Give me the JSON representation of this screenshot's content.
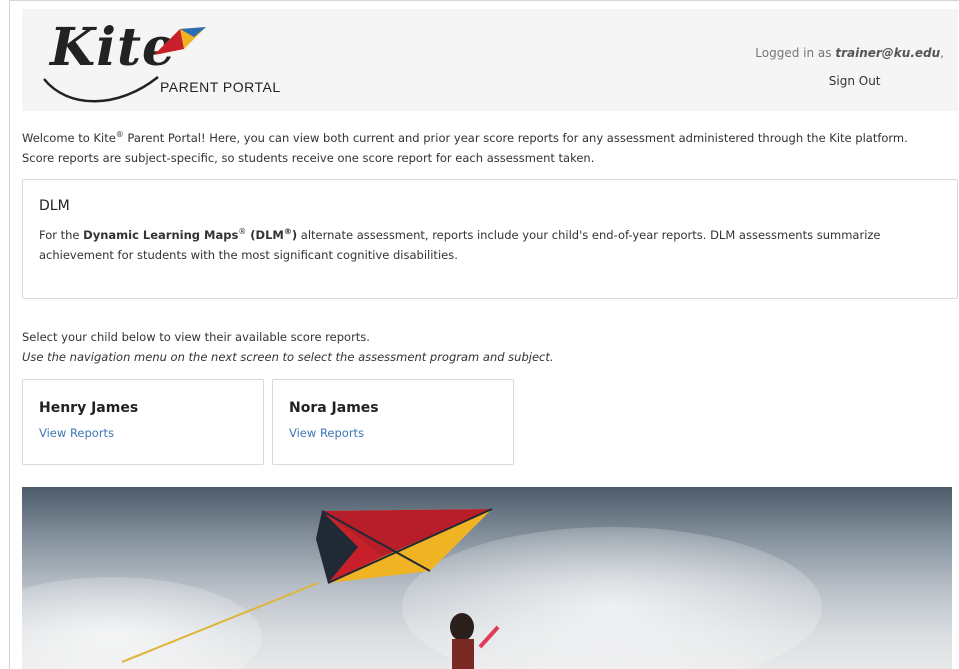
{
  "header": {
    "logo_main": "Kite",
    "logo_sub": "PARENT PORTAL",
    "logged_in_prefix": "Logged in as ",
    "user_email": "trainer@ku.edu",
    "user_suffix": ",",
    "sign_out": "Sign Out"
  },
  "intro": {
    "line1_prefix": "Welcome to Kite",
    "reg": "®",
    "line1_suffix": " Parent Portal! Here, you can view both current and prior year score reports for any assessment administered through the Kite platform.",
    "line2": "Score reports are subject-specific, so students receive one score report for each assessment taken."
  },
  "dlm": {
    "title": "DLM",
    "text_prefix": "For the ",
    "bold_name": "Dynamic Learning Maps",
    "reg": "®",
    "bold_abbr_open": " (DLM",
    "bold_abbr_close": ")",
    "text_suffix": " alternate assessment, reports include your child's end-of-year reports. DLM assessments summarize",
    "text_line2": "achievement for students with the most significant cognitive disabilities."
  },
  "select": {
    "line1": "Select your child below to view their available score reports.",
    "line2": "Use the navigation menu on the next screen to select the assessment program and subject."
  },
  "children": [
    {
      "name": "Henry James",
      "link": "View Reports"
    },
    {
      "name": "Nora James",
      "link": "View Reports"
    }
  ],
  "colors": {
    "header_bg": "#f5f5f5",
    "link": "#3a78b8",
    "kite_red": "#c8202a",
    "kite_yellow": "#f0b323",
    "kite_blue": "#2a6db5"
  }
}
